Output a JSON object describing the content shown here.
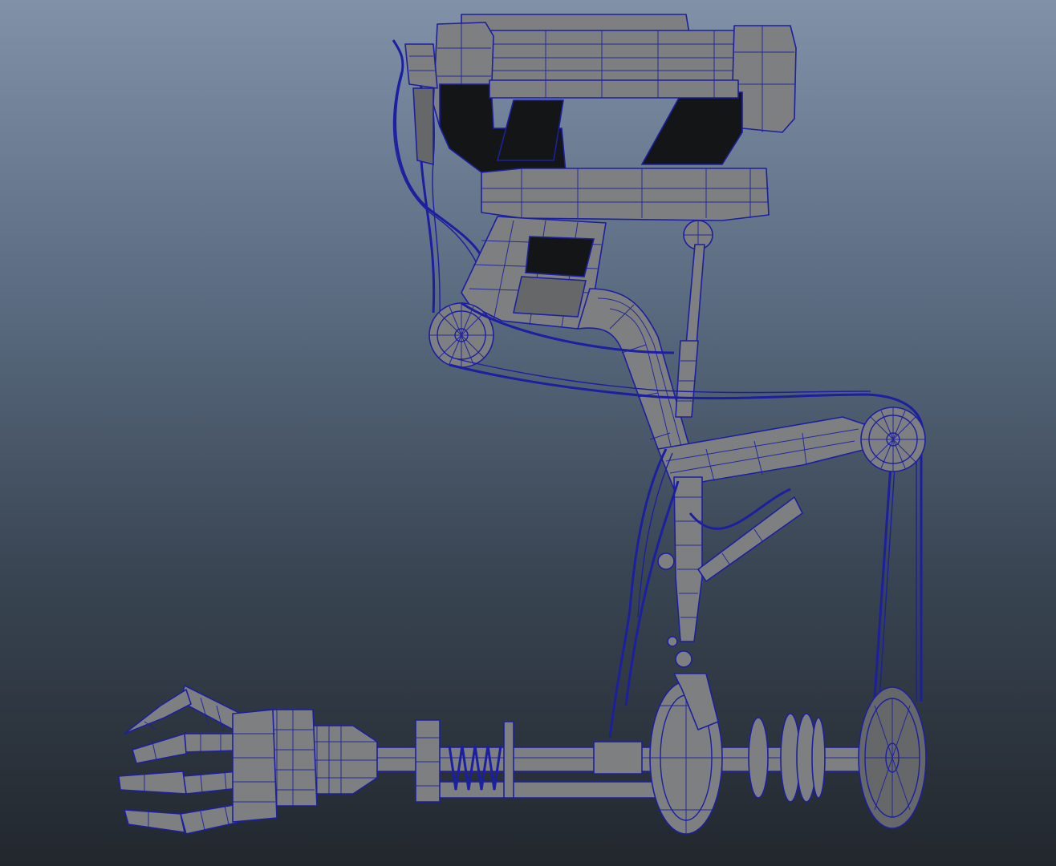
{
  "viewport": {
    "background_top": "#8091a8",
    "background_bottom": "#22272d",
    "shading": "wireframe-on-shaded",
    "wire_color": "#1c1fa0",
    "surface_color": "#7e7f80"
  },
  "model": {
    "parts": [
      "clamp-block",
      "upper-arm",
      "shoulder-pulley",
      "elbow-pulley",
      "forearm-strut",
      "drive-belt",
      "piston",
      "wrist-joint",
      "spring",
      "gripper-claw",
      "rear-wheel",
      "gear-disc"
    ]
  }
}
